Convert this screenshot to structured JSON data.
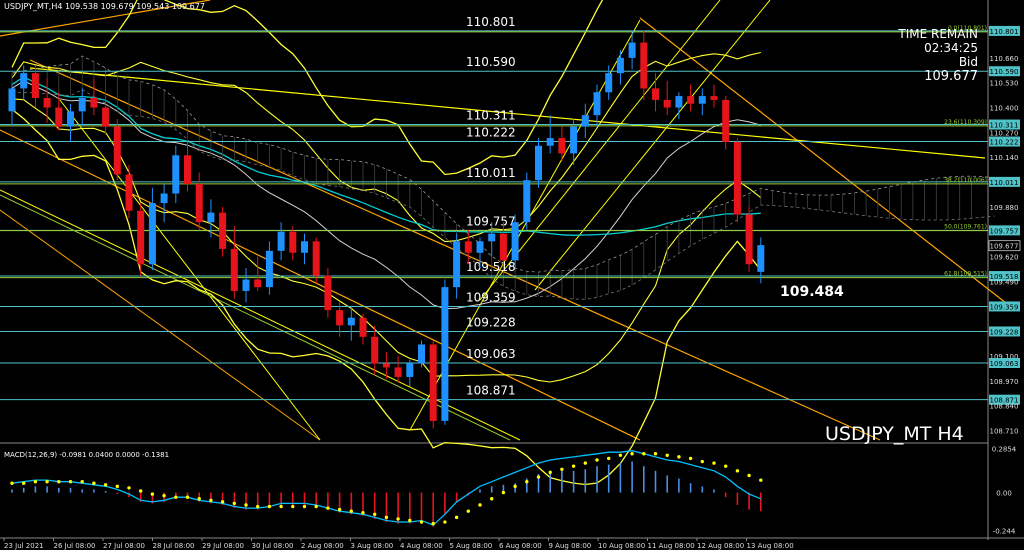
{
  "header": {
    "symbol_line": "USDJPY_MT,H4  109.538 109.679 109.543 109.677"
  },
  "info_box": {
    "time_remain_label": "TIME REMAIN",
    "time_remain_value": "02:34:25",
    "bid_label": "Bid",
    "bid_value": "109.677"
  },
  "watermark": "USDJPY_MT H4",
  "callout": "109.484",
  "macd_label": "MACD(12,26,9) -0.0981 0.0400 0.0000 -0.1381",
  "colors": {
    "background": "#000000",
    "bull": "#1e90ff",
    "bear": "#e8141c",
    "level_line": "#4fc3c8",
    "fib_line": "#9acd32",
    "band": "#ffff33",
    "trend": "#ffa500",
    "signal": "#ffff00",
    "macd_line": "#00bfff"
  },
  "chart_data": [
    {
      "type": "candlestick",
      "title": "USDJPY_MT H4",
      "ylim": [
        108.66,
        110.9
      ],
      "level_labels": [
        {
          "label": "110.801",
          "y": 110.801
        },
        {
          "label": "110.590",
          "y": 110.59
        },
        {
          "label": "110.311",
          "y": 110.311
        },
        {
          "label": "110.222",
          "y": 110.222
        },
        {
          "label": "110.011",
          "y": 110.011
        },
        {
          "label": "109.757",
          "y": 109.757
        },
        {
          "label": "109.518",
          "y": 109.518
        },
        {
          "label": "109.359",
          "y": 109.359
        },
        {
          "label": "109.228",
          "y": 109.228
        },
        {
          "label": "109.063",
          "y": 109.063
        },
        {
          "label": "108.871",
          "y": 108.871
        }
      ],
      "fib_labels": [
        {
          "label": "0.0(110.801)",
          "y": 110.801
        },
        {
          "label": "23.6(110.309)",
          "y": 110.309
        },
        {
          "label": "38.2(110.006)",
          "y": 110.006
        },
        {
          "label": "50.0(109.761)",
          "y": 109.761
        },
        {
          "label": "61.8(109.515)",
          "y": 109.515
        }
      ],
      "axis_ticks": [
        {
          "label": "110.801",
          "y": 110.801,
          "boxed": true
        },
        {
          "label": "110.660",
          "y": 110.66
        },
        {
          "label": "110.590",
          "y": 110.59,
          "boxed": true
        },
        {
          "label": "110.530",
          "y": 110.53
        },
        {
          "label": "110.400",
          "y": 110.4
        },
        {
          "label": "110.311",
          "y": 110.311,
          "boxed": true
        },
        {
          "label": "110.270",
          "y": 110.27
        },
        {
          "label": "110.222",
          "y": 110.222,
          "boxed": true
        },
        {
          "label": "110.140",
          "y": 110.14
        },
        {
          "label": "110.011",
          "y": 110.011,
          "boxed": true
        },
        {
          "label": "109.880",
          "y": 109.88
        },
        {
          "label": "109.757",
          "y": 109.757,
          "boxed": true
        },
        {
          "label": "109.677",
          "y": 109.677,
          "boxed": true,
          "dark": true
        },
        {
          "label": "109.620",
          "y": 109.62
        },
        {
          "label": "109.518",
          "y": 109.518,
          "boxed": true
        },
        {
          "label": "109.490",
          "y": 109.49
        },
        {
          "label": "109.359",
          "y": 109.359,
          "boxed": true
        },
        {
          "label": "109.228",
          "y": 109.228,
          "boxed": true
        },
        {
          "label": "109.100",
          "y": 109.1
        },
        {
          "label": "109.063",
          "y": 109.063,
          "boxed": true
        },
        {
          "label": "108.970",
          "y": 108.97
        },
        {
          "label": "108.871",
          "y": 108.871,
          "boxed": true
        },
        {
          "label": "108.840",
          "y": 108.84
        },
        {
          "label": "108.710",
          "y": 108.71
        }
      ],
      "x_labels": [
        "23 Jul 2021",
        "26 Jul 08:00",
        "27 Jul 08:00",
        "28 Jul 08:00",
        "29 Jul 08:00",
        "30 Jul 08:00",
        "2 Aug 08:00",
        "3 Aug 08:00",
        "4 Aug 08:00",
        "5 Aug 08:00",
        "6 Aug 08:00",
        "9 Aug 08:00",
        "10 Aug 08:00",
        "11 Aug 08:00",
        "12 Aug 08:00",
        "13 Aug 08:00"
      ],
      "candles": [
        [
          110.38,
          110.52,
          110.3,
          110.5
        ],
        [
          110.5,
          110.62,
          110.44,
          110.58
        ],
        [
          110.58,
          110.62,
          110.4,
          110.45
        ],
        [
          110.45,
          110.55,
          110.32,
          110.4
        ],
        [
          110.4,
          110.48,
          110.28,
          110.3
        ],
        [
          110.3,
          110.42,
          110.22,
          110.38
        ],
        [
          110.38,
          110.5,
          110.3,
          110.45
        ],
        [
          110.45,
          110.55,
          110.36,
          110.4
        ],
        [
          110.4,
          110.46,
          110.26,
          110.3
        ],
        [
          110.3,
          110.34,
          110.02,
          110.05
        ],
        [
          110.05,
          110.1,
          109.82,
          109.86
        ],
        [
          109.86,
          109.9,
          109.52,
          109.58
        ],
        [
          109.58,
          109.98,
          109.55,
          109.9
        ],
        [
          109.9,
          110.0,
          109.8,
          109.95
        ],
        [
          109.95,
          110.2,
          109.9,
          110.15
        ],
        [
          110.15,
          110.22,
          109.96,
          110.0
        ],
        [
          110.0,
          110.06,
          109.76,
          109.8
        ],
        [
          109.8,
          109.92,
          109.72,
          109.85
        ],
        [
          109.85,
          109.88,
          109.62,
          109.66
        ],
        [
          109.66,
          109.78,
          109.4,
          109.44
        ],
        [
          109.44,
          109.56,
          109.38,
          109.5
        ],
        [
          109.5,
          109.62,
          109.44,
          109.46
        ],
        [
          109.46,
          109.7,
          109.42,
          109.65
        ],
        [
          109.65,
          109.8,
          109.6,
          109.75
        ],
        [
          109.75,
          109.78,
          109.6,
          109.64
        ],
        [
          109.64,
          109.74,
          109.58,
          109.7
        ],
        [
          109.7,
          109.72,
          109.48,
          109.52
        ],
        [
          109.52,
          109.56,
          109.3,
          109.34
        ],
        [
          109.34,
          109.38,
          109.2,
          109.26
        ],
        [
          109.26,
          109.36,
          109.18,
          109.3
        ],
        [
          109.3,
          109.32,
          109.16,
          109.2
        ],
        [
          109.2,
          109.26,
          109.0,
          109.06
        ],
        [
          109.06,
          109.12,
          108.98,
          109.04
        ],
        [
          109.04,
          109.1,
          108.96,
          108.99
        ],
        [
          108.99,
          109.08,
          108.94,
          109.06
        ],
        [
          109.06,
          109.18,
          109.04,
          109.16
        ],
        [
          109.16,
          109.18,
          108.72,
          108.76
        ],
        [
          108.76,
          109.5,
          108.74,
          109.46
        ],
        [
          109.46,
          109.74,
          109.4,
          109.7
        ],
        [
          109.7,
          109.76,
          109.58,
          109.64
        ],
        [
          109.64,
          109.72,
          109.56,
          109.7
        ],
        [
          109.7,
          109.8,
          109.62,
          109.74
        ],
        [
          109.74,
          109.8,
          109.55,
          109.6
        ],
        [
          109.6,
          109.84,
          109.56,
          109.8
        ],
        [
          109.8,
          110.06,
          109.76,
          110.02
        ],
        [
          110.02,
          110.24,
          109.98,
          110.2
        ],
        [
          110.2,
          110.36,
          110.16,
          110.24
        ],
        [
          110.24,
          110.3,
          110.12,
          110.16
        ],
        [
          110.16,
          110.34,
          110.1,
          110.3
        ],
        [
          110.3,
          110.42,
          110.24,
          110.36
        ],
        [
          110.36,
          110.52,
          110.3,
          110.48
        ],
        [
          110.48,
          110.62,
          110.44,
          110.58
        ],
        [
          110.58,
          110.7,
          110.52,
          110.66
        ],
        [
          110.66,
          110.8,
          110.6,
          110.74
        ],
        [
          110.74,
          110.8,
          110.44,
          110.5
        ],
        [
          110.5,
          110.58,
          110.38,
          110.44
        ],
        [
          110.44,
          110.54,
          110.36,
          110.4
        ],
        [
          110.4,
          110.48,
          110.34,
          110.46
        ],
        [
          110.46,
          110.52,
          110.38,
          110.42
        ],
        [
          110.42,
          110.5,
          110.36,
          110.46
        ],
        [
          110.46,
          110.52,
          110.4,
          110.44
        ],
        [
          110.44,
          110.46,
          110.18,
          110.22
        ],
        [
          110.22,
          110.24,
          109.8,
          109.84
        ],
        [
          109.84,
          109.88,
          109.54,
          109.58
        ],
        [
          109.54,
          109.72,
          109.48,
          109.68
        ]
      ],
      "macd": {
        "ylim": [
          -0.28,
          0.3
        ],
        "tick_labels": [
          {
            "label": "0.2854",
            "y": 0.2854
          },
          {
            "label": "0.00",
            "y": 0.0
          },
          {
            "label": "-0.244",
            "y": -0.244
          }
        ],
        "histogram": [
          0.02,
          0.03,
          0.04,
          0.04,
          0.03,
          0.03,
          0.02,
          0.02,
          0.01,
          -0.01,
          -0.03,
          -0.06,
          -0.07,
          -0.06,
          -0.04,
          -0.04,
          -0.06,
          -0.07,
          -0.08,
          -0.1,
          -0.11,
          -0.11,
          -0.1,
          -0.08,
          -0.08,
          -0.08,
          -0.09,
          -0.11,
          -0.13,
          -0.14,
          -0.15,
          -0.17,
          -0.19,
          -0.2,
          -0.2,
          -0.19,
          -0.22,
          -0.14,
          -0.06,
          -0.02,
          0.02,
          0.04,
          0.05,
          0.06,
          0.09,
          0.12,
          0.14,
          0.14,
          0.14,
          0.15,
          0.17,
          0.18,
          0.19,
          0.2,
          0.17,
          0.14,
          0.11,
          0.09,
          0.06,
          0.04,
          0.02,
          -0.03,
          -0.08,
          -0.11,
          -0.12
        ],
        "line": [
          0.06,
          0.07,
          0.08,
          0.08,
          0.07,
          0.07,
          0.06,
          0.05,
          0.04,
          0.02,
          -0.01,
          -0.05,
          -0.06,
          -0.05,
          -0.03,
          -0.03,
          -0.05,
          -0.06,
          -0.07,
          -0.09,
          -0.1,
          -0.1,
          -0.09,
          -0.07,
          -0.07,
          -0.07,
          -0.08,
          -0.1,
          -0.12,
          -0.13,
          -0.14,
          -0.16,
          -0.18,
          -0.19,
          -0.19,
          -0.18,
          -0.21,
          -0.14,
          -0.06,
          -0.01,
          0.04,
          0.07,
          0.1,
          0.13,
          0.16,
          0.19,
          0.21,
          0.22,
          0.23,
          0.24,
          0.25,
          0.26,
          0.26,
          0.27,
          0.25,
          0.23,
          0.21,
          0.2,
          0.18,
          0.16,
          0.14,
          0.1,
          0.04,
          -0.01,
          -0.04
        ],
        "signal": [
          0.06,
          0.06,
          0.07,
          0.07,
          0.07,
          0.07,
          0.07,
          0.06,
          0.05,
          0.04,
          0.03,
          0.01,
          -0.01,
          -0.02,
          -0.03,
          -0.03,
          -0.04,
          -0.05,
          -0.06,
          -0.07,
          -0.08,
          -0.09,
          -0.09,
          -0.09,
          -0.09,
          -0.09,
          -0.09,
          -0.1,
          -0.11,
          -0.12,
          -0.13,
          -0.14,
          -0.16,
          -0.17,
          -0.18,
          -0.19,
          -0.2,
          -0.19,
          -0.16,
          -0.12,
          -0.08,
          -0.04,
          0.0,
          0.04,
          0.07,
          0.1,
          0.13,
          0.15,
          0.17,
          0.19,
          0.21,
          0.22,
          0.24,
          0.25,
          0.25,
          0.25,
          0.24,
          0.23,
          0.22,
          0.2,
          0.19,
          0.17,
          0.14,
          0.11,
          0.08
        ]
      }
    }
  ]
}
